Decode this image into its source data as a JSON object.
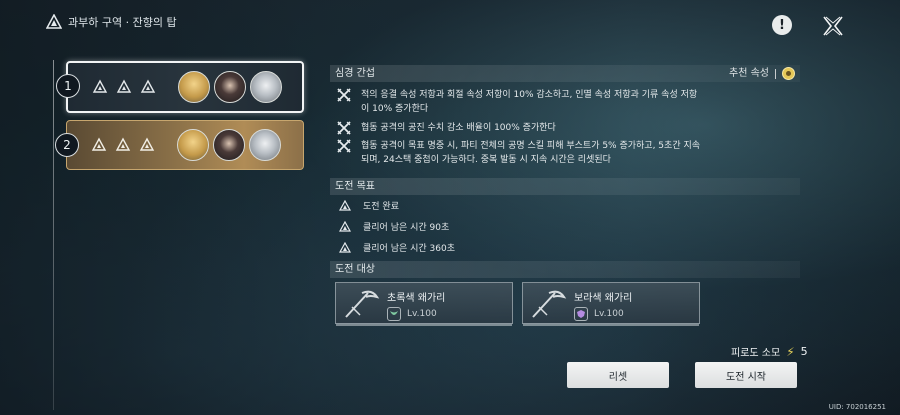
{
  "header": {
    "breadcrumb": "과부하 구역 · 잔향의 탑",
    "icons": [
      "tower-logo-icon",
      "info-icon",
      "close-x-icon"
    ]
  },
  "stages": [
    {
      "number": "1",
      "stars": 3,
      "selected": true
    },
    {
      "number": "2",
      "stars": 3,
      "selected": false
    }
  ],
  "resonance": {
    "title": "심경 간섭",
    "recommend_label": "추천 속성",
    "effects": [
      "적의 응결 속성 저항과 회절 속성 저항이 10% 감소하고, 인멸 속성 저항과 기류 속성 저항이 10% 증가한다",
      "협동 공격의 공진 수치 감소 배율이 100% 증가한다",
      "협동 공격이 목표 명중 시, 파티 전체의 공명 스킬 피해 부스트가 5% 증가하고, 5초간 지속되며, 24스택 중첩이 가능하다. 중복 발동 시 지속 시간은 리셋된다"
    ]
  },
  "goals": {
    "title": "도전 목표",
    "items": [
      "도전 완료",
      "클리어 남은 시간 90초",
      "클리어 남은 시간 360초"
    ]
  },
  "targets": {
    "title": "도전 대상",
    "items": [
      {
        "name": "초록색 왜가리",
        "level": "Lv.100",
        "attr_color": "#7fc9a0"
      },
      {
        "name": "보라색 왜가리",
        "level": "Lv.100",
        "attr_color": "#b48be0"
      }
    ]
  },
  "fatigue": {
    "label": "피로도 소모",
    "value": "5"
  },
  "buttons": {
    "reset": "리셋",
    "start": "도전 시작"
  },
  "uid": "UID: 702016251",
  "colors": {
    "accent_gold": "#e5c857",
    "selected_border": "#f2f4f5",
    "stage2_bg": "#b08c56"
  }
}
